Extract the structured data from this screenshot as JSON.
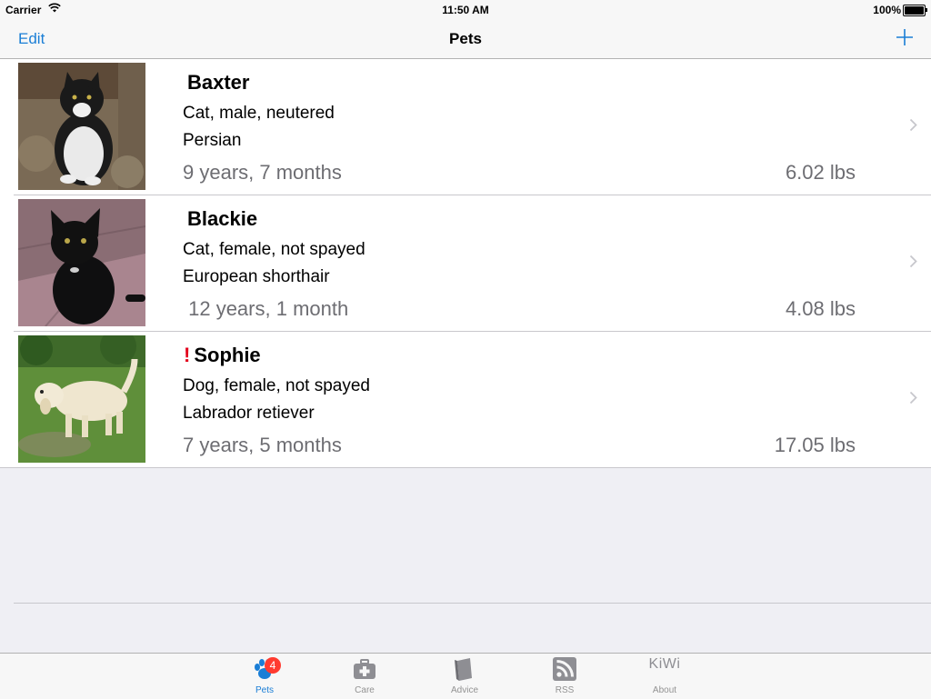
{
  "status_bar": {
    "carrier": "Carrier",
    "time": "11:50 AM",
    "battery": "100%"
  },
  "nav_bar": {
    "edit_label": "Edit",
    "title": "Pets",
    "add_icon": "plus-icon"
  },
  "pets": [
    {
      "name": "Baxter",
      "alert": "",
      "description": "Cat, male, neutered",
      "breed": "Persian",
      "age": "9 years, 7 months",
      "weight": "6.02 lbs",
      "photo": "black-and-white-cat"
    },
    {
      "name": "Blackie",
      "alert": "",
      "description": "Cat, female, not spayed",
      "breed": "European shorthair",
      "age": " 12 years, 1 month",
      "weight": "4.08 lbs",
      "photo": "black-cat"
    },
    {
      "name": "Sophie",
      "alert": "!",
      "description": "Dog, female, not spayed",
      "breed": "Labrador retiever",
      "age": "7 years, 5 months",
      "weight": "17.05 lbs",
      "photo": "white-dog-on-grass"
    }
  ],
  "tab_bar": {
    "tabs": [
      {
        "label": "Pets",
        "icon": "paw-icon",
        "badge": "4",
        "active": true
      },
      {
        "label": "Care",
        "icon": "first-aid-kit-icon",
        "active": false
      },
      {
        "label": "Advice",
        "icon": "book-icon",
        "active": false
      },
      {
        "label": "RSS",
        "icon": "rss-icon",
        "active": false
      },
      {
        "label": "About",
        "icon_text": "KiWi",
        "active": false
      }
    ]
  },
  "colors": {
    "accent": "#1a7ed6",
    "alert": "#e3001b",
    "badge": "#ff3b30",
    "secondary_text": "#6d6d72"
  }
}
